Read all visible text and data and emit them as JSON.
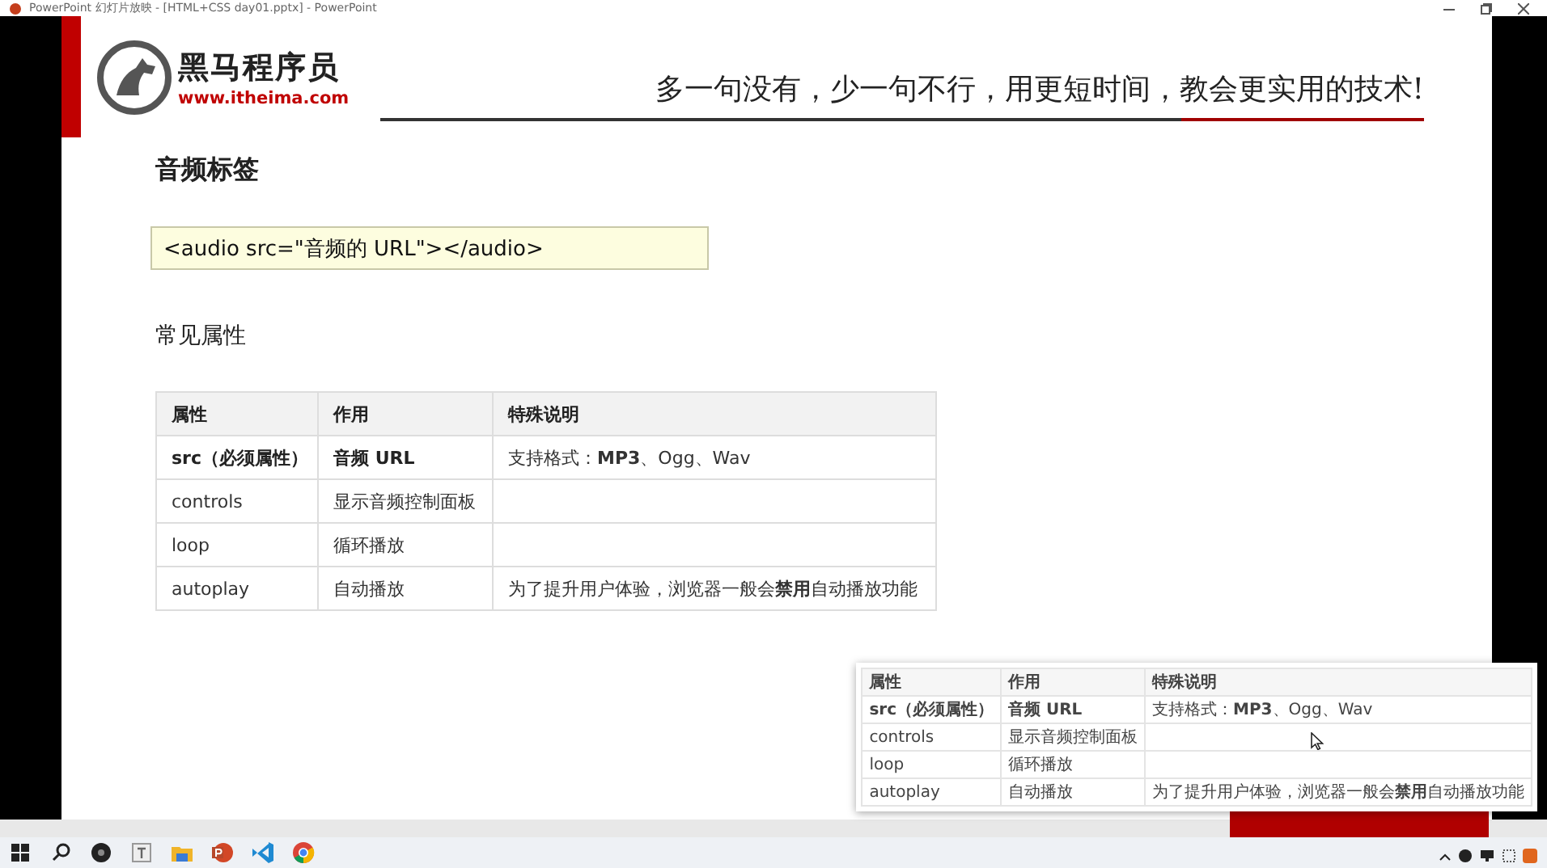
{
  "window": {
    "title": "PowerPoint 幻灯片放映 - [HTML+CSS day01.pptx] - PowerPoint"
  },
  "slide": {
    "brand": {
      "name": "黑马程序员",
      "url": "www.itheima.com"
    },
    "slogan": "多一句没有，少一句不行，用更短时间，教会更实用的技术!",
    "title": "音频标签",
    "code": "<audio src=\"音频的 URL\"></audio>",
    "subtitle": "常见属性",
    "table": {
      "columns": [
        "属性",
        "作用",
        "特殊说明"
      ],
      "rows": [
        {
          "cells": [
            {
              "text": "src（必须属性）",
              "bold": true
            },
            {
              "text": "音频 URL",
              "bold": true
            },
            {
              "text": "支持格式：**MP3**、Ogg、Wav",
              "bold": false
            }
          ]
        },
        {
          "cells": [
            {
              "text": "controls",
              "bold": false
            },
            {
              "text": "显示音频控制面板",
              "bold": false
            },
            {}
          ]
        },
        {
          "cells": [
            {
              "text": "loop",
              "bold": false
            },
            {
              "text": "循环播放",
              "bold": false
            },
            {}
          ]
        },
        {
          "cells": [
            {
              "text": "autoplay",
              "bold": false
            },
            {
              "text": "自动播放",
              "bold": false
            },
            {
              "text": "为了提升用户体验，浏览器一般会**禁用**自动播放功能",
              "bold": false
            }
          ]
        }
      ]
    }
  },
  "snippet_popup": {
    "table": {
      "columns": [
        "属性",
        "作用",
        "特殊说明"
      ],
      "rows": [
        {
          "cells": [
            {
              "text": "src（必须属性）",
              "bold": true
            },
            {
              "text": "音频 URL",
              "bold": true
            },
            {
              "text": "支持格式：**MP3**、Ogg、Wav",
              "bold": false
            }
          ]
        },
        {
          "cells": [
            {
              "text": "controls",
              "bold": false
            },
            {
              "text": "显示音频控制面板",
              "bold": false
            },
            {}
          ]
        },
        {
          "cells": [
            {
              "text": "loop",
              "bold": false
            },
            {
              "text": "循环播放",
              "bold": false
            },
            {}
          ]
        },
        {
          "cells": [
            {
              "text": "autoplay",
              "bold": false
            },
            {
              "text": "自动播放",
              "bold": false
            },
            {
              "text": "为了提升用户体验，浏览器一般会**禁用**自动播放功能",
              "bold": false
            }
          ]
        }
      ]
    }
  },
  "taskbar": {
    "apps": [
      {
        "kind": "start"
      },
      {
        "kind": "search"
      },
      {
        "kind": "circle"
      },
      {
        "kind": "text"
      },
      {
        "kind": "folder"
      },
      {
        "kind": "presentation"
      },
      {
        "kind": "code"
      },
      {
        "kind": "browser"
      }
    ]
  }
}
